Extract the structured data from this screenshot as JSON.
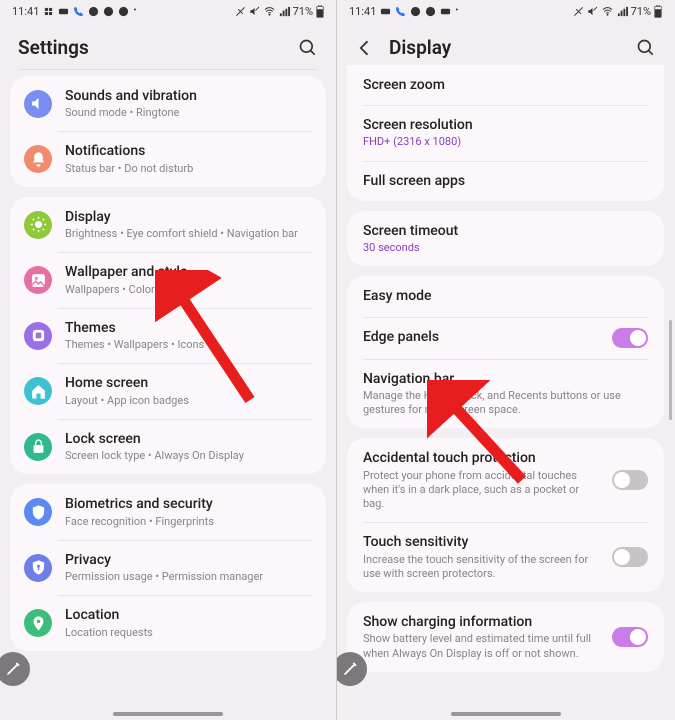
{
  "status": {
    "time": "11:41",
    "battery_pct": "71%"
  },
  "left": {
    "header_title": "Settings",
    "groups": [
      {
        "items": [
          {
            "icon": "sound",
            "color": "#7a8df0",
            "title": "Sounds and vibration",
            "sub": "Sound mode  •  Ringtone"
          },
          {
            "icon": "bell",
            "color": "#f08b6d",
            "title": "Notifications",
            "sub": "Status bar  •  Do not disturb"
          }
        ]
      },
      {
        "items": [
          {
            "icon": "display",
            "color": "#8fc93a",
            "title": "Display",
            "sub": "Brightness  •  Eye comfort shield  •  Navigation bar"
          },
          {
            "icon": "wallpaper",
            "color": "#e86fa6",
            "title": "Wallpaper and style",
            "sub": "Wallpapers  •  Color palette"
          },
          {
            "icon": "themes",
            "color": "#9a6fe8",
            "title": "Themes",
            "sub": "Themes  •  Wallpapers  •  Icons"
          },
          {
            "icon": "home",
            "color": "#3fc1d4",
            "title": "Home screen",
            "sub": "Layout  •  App icon badges"
          },
          {
            "icon": "lock",
            "color": "#2fb98c",
            "title": "Lock screen",
            "sub": "Screen lock type  •  Always On Display"
          }
        ]
      },
      {
        "items": [
          {
            "icon": "shield",
            "color": "#5d8af0",
            "title": "Biometrics and security",
            "sub": "Face recognition  •  Fingerprints"
          },
          {
            "icon": "privacy",
            "color": "#6e7fe8",
            "title": "Privacy",
            "sub": "Permission usage  •  Permission manager"
          },
          {
            "icon": "location",
            "color": "#3dbd7a",
            "title": "Location",
            "sub": "Location requests"
          }
        ]
      }
    ]
  },
  "right": {
    "header_title": "Display",
    "groups": [
      {
        "items": [
          {
            "title": "Screen zoom"
          },
          {
            "title": "Screen resolution",
            "sub": "FHD+ (2316 x 1080)",
            "accent": true
          },
          {
            "title": "Full screen apps"
          }
        ]
      },
      {
        "items": [
          {
            "title": "Screen timeout",
            "sub": "30 seconds",
            "accent": true
          }
        ]
      },
      {
        "items": [
          {
            "title": "Easy mode"
          },
          {
            "title": "Edge panels",
            "toggle": "on"
          },
          {
            "title": "Navigation bar",
            "sub": "Manage the Home, Back, and Recents buttons or use gestures for more screen space."
          }
        ]
      },
      {
        "items": [
          {
            "title": "Accidental touch protection",
            "sub": "Protect your phone from accidental touches when it's in a dark place, such as a pocket or bag.",
            "toggle": "off"
          },
          {
            "title": "Touch sensitivity",
            "sub": "Increase the touch sensitivity of the screen for use with screen protectors.",
            "toggle": "off"
          }
        ]
      },
      {
        "items": [
          {
            "title": "Show charging information",
            "sub": "Show battery level and estimated time until full when Always On Display is off or not shown.",
            "toggle": "on"
          }
        ]
      }
    ]
  }
}
